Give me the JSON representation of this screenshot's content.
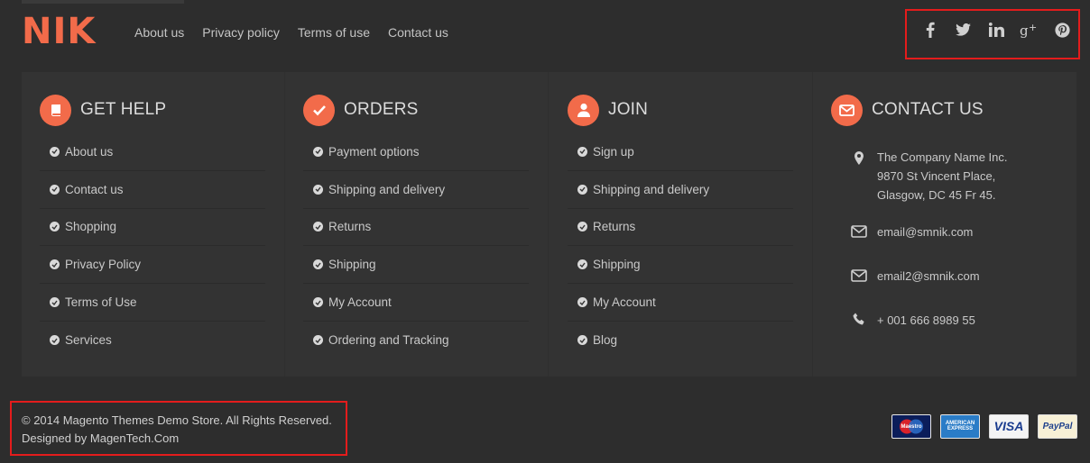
{
  "logo": {
    "text": "NIK"
  },
  "topnav": [
    "About us",
    "Privacy policy",
    "Terms of use",
    "Contact us"
  ],
  "social": [
    "facebook-icon",
    "twitter-icon",
    "linkedin-icon",
    "google-plus-icon",
    "pinterest-icon"
  ],
  "columns": [
    {
      "title": "GET HELP",
      "icon": "book-icon",
      "links": [
        "About us",
        "Contact us",
        "Shopping",
        "Privacy Policy",
        "Terms of Use",
        "Services"
      ]
    },
    {
      "title": "ORDERS",
      "icon": "check-icon",
      "links": [
        "Payment options",
        "Shipping and delivery",
        "Returns",
        "Shipping",
        "My Account",
        "Ordering and Tracking"
      ]
    },
    {
      "title": "JOIN",
      "icon": "user-icon",
      "links": [
        "Sign up",
        "Shipping and delivery",
        "Returns",
        "Shipping",
        "My Account",
        "Blog"
      ]
    }
  ],
  "contact": {
    "title": "CONTACT US",
    "address": [
      "The Company Name Inc.",
      "9870 St Vincent Place,",
      "Glasgow, DC 45 Fr 45."
    ],
    "email1": "email@smnik.com",
    "email2": "email2@smnik.com",
    "phone": "+ 001 666 8989 55"
  },
  "copyright": {
    "line1": "© 2014 Magento Themes Demo Store. All Rights Reserved.",
    "line2": "Designed by MagenTech.Com"
  },
  "payments": {
    "maestro": "Maestro",
    "amex_line1": "AMERICAN",
    "amex_line2": "EXPRESS",
    "visa": "VISA",
    "paypal": "PayPal"
  },
  "colors": {
    "accent": "#f26b4a",
    "background": "#2d2d2d",
    "panel": "#333333",
    "highlight_border": "#e41c1c"
  }
}
